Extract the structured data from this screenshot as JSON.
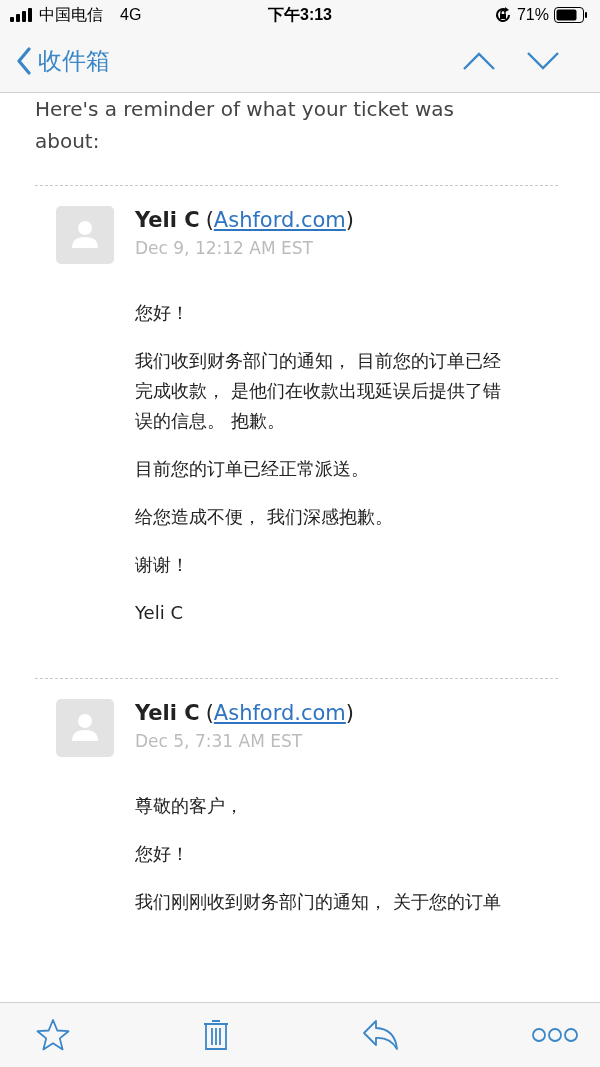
{
  "status_bar": {
    "carrier": "中国电信",
    "network": "4G",
    "time": "下午3:13",
    "battery": "71%"
  },
  "nav": {
    "back_label": "收件箱"
  },
  "intro_lines": [
    "Here's a reminder of what your ticket was",
    "about:"
  ],
  "messages": [
    {
      "sender": "Yeli C",
      "open": "(",
      "link": "Ashford.com",
      "close": ")",
      "date": "Dec 9, 12:12 AM EST",
      "paragraphs": [
        "您好！",
        "我们收到财务部门的通知， 目前您的订单已经完成收款， 是他们在收款出现延误后提供了错误的信息。 抱歉。",
        "目前您的订单已经正常派送。",
        "给您造成不便， 我们深感抱歉。",
        "谢谢！",
        "Yeli C"
      ]
    },
    {
      "sender": "Yeli C",
      "open": "(",
      "link": "Ashford.com",
      "close": ")",
      "date": "Dec 5, 7:31 AM EST",
      "paragraphs": [
        "尊敬的客户，",
        "您好！",
        "我们刚刚收到财务部门的通知， 关于您的订单"
      ]
    }
  ]
}
